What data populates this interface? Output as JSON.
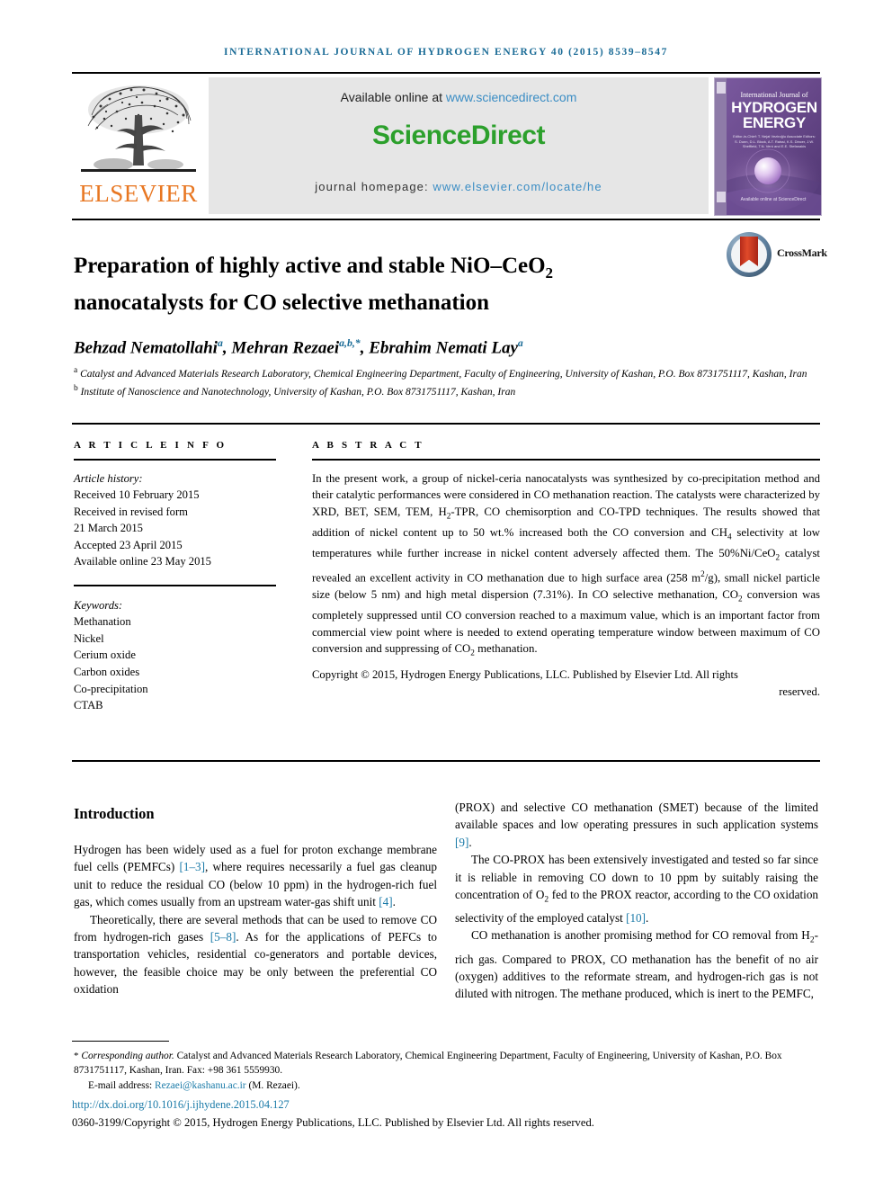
{
  "running_head": "INTERNATIONAL JOURNAL OF HYDROGEN ENERGY 40 (2015) 8539–8547",
  "masthead": {
    "publisher_name": "ELSEVIER",
    "publisher_logo_alt": "elsevier-tree-logo",
    "available_online_prefix": "Available online at ",
    "sciencedirect_url": "www.sciencedirect.com",
    "sciencedirect_logo": "ScienceDirect",
    "homepage_prefix": "journal homepage: ",
    "homepage_url": "www.elsevier.com/locate/he",
    "cover": {
      "line1": "International Journal of",
      "line2": "HYDROGEN",
      "line3": "ENERGY",
      "editors": "Editor-in-Chief: T. Nejat Veziroğlu  Associate Editors: S. Dunn, D.L. Block, A.T. Raissi, K.S. Dincer, J.W. Sheffield, T.N. Veró and E.E. Stefanakis",
      "sciencedirect_mark": "Available online at ScienceDirect"
    }
  },
  "article": {
    "title_part1": "Preparation of highly active and stable NiO",
    "title_dash": "–",
    "title_ceo": "CeO",
    "title_sub": "2",
    "title_line2": "nanocatalysts for CO selective methanation",
    "crossmark_label": "CrossMark",
    "authors": [
      {
        "name": "Behzad Nematollahi",
        "marks": "a"
      },
      {
        "name": "Mehran Rezaei",
        "marks": "a,b,*"
      },
      {
        "name": "Ebrahim Nemati Lay",
        "marks": "a"
      }
    ],
    "affiliations": [
      {
        "mark": "a",
        "text": "Catalyst and Advanced Materials Research Laboratory, Chemical Engineering Department, Faculty of Engineering, University of Kashan, P.O. Box 8731751117, Kashan, Iran"
      },
      {
        "mark": "b",
        "text": "Institute of Nanoscience and Nanotechnology, University of Kashan, P.O. Box 8731751117, Kashan, Iran"
      }
    ]
  },
  "article_info": {
    "heading": "A R T I C L E   I N F O",
    "history_label": "Article history:",
    "history": [
      "Received 10 February 2015",
      "Received in revised form",
      "21 March 2015",
      "Accepted 23 April 2015",
      "Available online 23 May 2015"
    ],
    "keywords_label": "Keywords:",
    "keywords": [
      "Methanation",
      "Nickel",
      "Cerium oxide",
      "Carbon oxides",
      "Co-precipitation",
      "CTAB"
    ]
  },
  "abstract": {
    "heading": "A B S T R A C T",
    "paragraphs": [
      "In the present work, a group of nickel-ceria nanocatalysts was synthesized by co-precipitation method and their catalytic performances were considered in CO methanation reaction. The catalysts were characterized by XRD, BET, SEM, TEM, H2-TPR, CO chemisorption and CO-TPD techniques. The results showed that addition of nickel content up to 50 wt.% increased both the CO conversion and CH4 selectivity at low temperatures while further increase in nickel content adversely affected them. The 50%Ni/CeO2 catalyst revealed an excellent activity in CO methanation due to high surface area (258 m2/g), small nickel particle size (below 5 nm) and high metal dispersion (7.31%). In CO selective methanation, CO2 conversion was completely suppressed until CO conversion reached to a maximum value, which is an important factor from commercial view point where is needed to extend operating temperature window between maximum of CO conversion and suppressing of CO2 methanation."
    ],
    "copyright": "Copyright © 2015, Hydrogen Energy Publications, LLC. Published by Elsevier Ltd. All rights",
    "copyright_last": "reserved."
  },
  "introduction": {
    "heading": "Introduction",
    "left_paragraphs": [
      "Hydrogen has been widely used as a fuel for proton exchange membrane fuel cells (PEMFCs) [1–3], where requires necessarily a fuel gas cleanup unit to reduce the residual CO (below 10 ppm) in the hydrogen-rich fuel gas, which comes usually from an upstream water-gas shift unit [4].",
      "Theoretically, there are several methods that can be used to remove CO from hydrogen-rich gases [5–8]. As for the applications of PEFCs to transportation vehicles, residential co-generators and portable devices, however, the feasible choice may be only between the preferential CO oxidation"
    ],
    "right_paragraphs": [
      "(PROX) and selective CO methanation (SMET) because of the limited available spaces and low operating pressures in such application systems [9].",
      "The CO-PROX has been extensively investigated and tested so far since it is reliable in removing CO down to 10 ppm by suitably raising the concentration of O2 fed to the PROX reactor, according to the CO oxidation selectivity of the employed catalyst [10].",
      "CO methanation is another promising method for CO removal from H2-rich gas. Compared to PROX, CO methanation has the benefit of no air (oxygen) additives to the reformate stream, and hydrogen-rich gas is not diluted with nitrogen. The methane produced, which is inert to the PEMFC,"
    ]
  },
  "footer": {
    "corresponding_star": "*",
    "corresponding_label": "Corresponding author.",
    "corresponding_text": " Catalyst and Advanced Materials Research Laboratory, Chemical Engineering Department, Faculty of Engineering, University of Kashan, P.O. Box 8731751117, Kashan, Iran. Fax: +98 361 5559930.",
    "email_label": "E-mail address: ",
    "email": "Rezaei@kashanu.ac.ir",
    "email_suffix": " (M. Rezaei).",
    "doi": "http://dx.doi.org/10.1016/j.ijhydene.2015.04.127",
    "issn": "0360-3199/Copyright © 2015, Hydrogen Energy Publications, LLC. Published by Elsevier Ltd. All rights reserved."
  },
  "colors": {
    "link_blue": "#1a7aa8",
    "header_blue": "#1a6b96",
    "elsevier_orange": "#e87722",
    "sciencedirect_green": "#2ca02c"
  }
}
